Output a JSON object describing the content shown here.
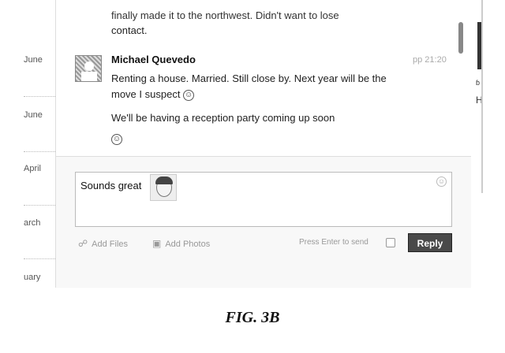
{
  "sidebar": {
    "months": [
      "June",
      "June",
      "April",
      "arch",
      "uary"
    ]
  },
  "conversation": {
    "previous_message": "finally made it to the northwest. Didn't want to lose",
    "previous_message_end": "contact.",
    "sender": "Michael Quevedo",
    "timestamp": "pp 21:20",
    "message_1": "Renting a house. Married. Still close by. Next year will be the move I suspect",
    "message_2": "We'll be having a reception party coming up soon",
    "smiley_glyph": "☺"
  },
  "composer": {
    "reply_text": "Sounds great",
    "add_files_label": "Add Files",
    "add_photos_label": "Add Photos",
    "press_enter_label": "Press Enter to send",
    "reply_button_label": "Reply",
    "emoji_glyph": "☺"
  },
  "right_fragments": {
    "char_top": "ɓ",
    "char_bottom": "H"
  },
  "caption": "FIG. 3B",
  "icons": {
    "add_files": "paperclip-icon",
    "add_photos": "photo-icon",
    "emoji": "smiley-icon"
  }
}
